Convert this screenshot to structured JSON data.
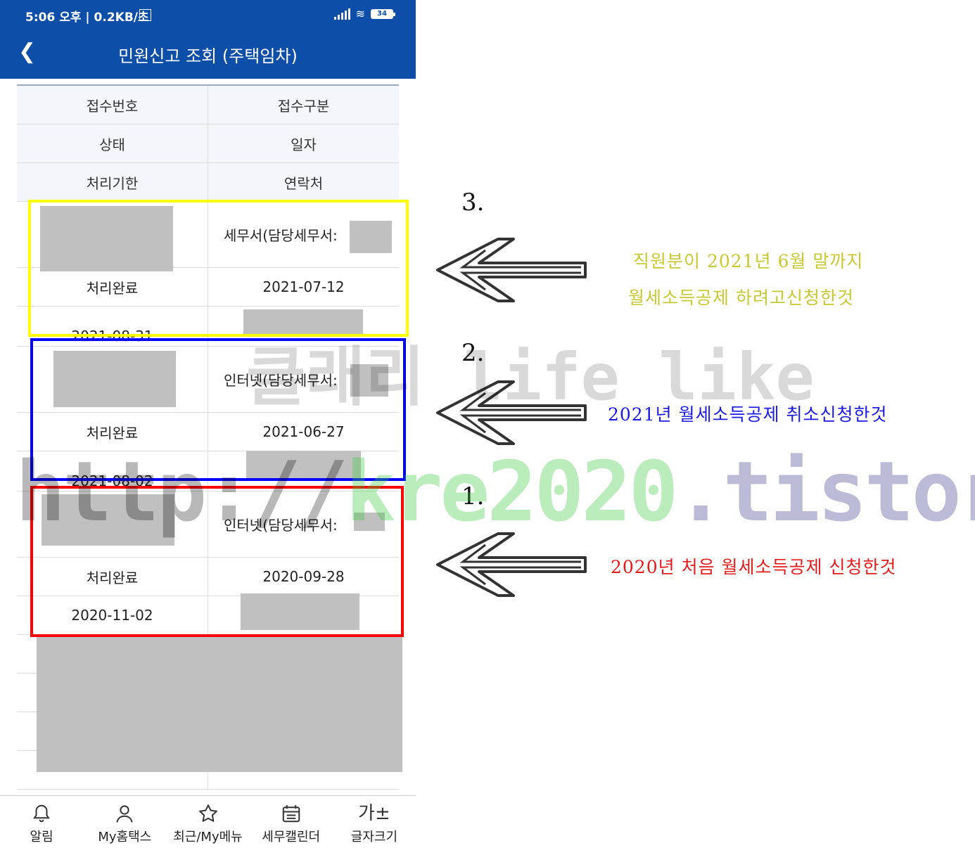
{
  "status_bar": {
    "time": "5:06 오후 | 0.2KB/초",
    "battery": "34"
  },
  "app_bar": {
    "title": "민원신고 조회 (주택임차)"
  },
  "table": {
    "header": [
      [
        "접수번호",
        "접수구분"
      ],
      [
        "상태",
        "일자"
      ],
      [
        "처리기한",
        "연락처"
      ]
    ],
    "records": [
      {
        "type": "세무서(담당세무서:",
        "status": "처리완료",
        "date": "2021-07-12",
        "deadline": "2021-08-31"
      },
      {
        "type": "인터넷(담당세무서:",
        "status": "처리완료",
        "date": "2021-06-27",
        "deadline": "2021-08-02"
      },
      {
        "type": "인터넷(담당세무서: ",
        "status": "처리완료",
        "date": "2020-09-28",
        "deadline": "2020-11-02"
      }
    ]
  },
  "bottom_nav": [
    {
      "label": "알림",
      "icon": "bell-icon"
    },
    {
      "label": "My홈택스",
      "icon": "person-icon"
    },
    {
      "label": "최근/My메뉴",
      "icon": "star-icon"
    },
    {
      "label": "세무캘린더",
      "icon": "calendar-icon"
    },
    {
      "label": "글자크기",
      "icon": "font-size-icon",
      "glyph": "가±"
    }
  ],
  "annotations": [
    {
      "number": "3.",
      "lines": [
        "직원분이 2021년 6월 말까지",
        "월세소득공제 하려고신청한것"
      ],
      "color": "#c8c832"
    },
    {
      "number": "2.",
      "lines": [
        "2021년 월세소득공제 취소신청한것"
      ],
      "color": "#1a1ae6"
    },
    {
      "number": "1.",
      "lines": [
        "2020년 처음 월세소득공제 신청한것"
      ],
      "color": "#e61a1a"
    }
  ],
  "box_colors": [
    "#ffff00",
    "#0000ff",
    "#ff0000"
  ],
  "watermark": {
    "line1": "클래리 life like",
    "line2_a": "http://",
    "line2_b": "kre2020",
    "line2_c": ".tistory.com"
  },
  "colors": {
    "primary": "#0d4ea8",
    "status_done": "#d31a1a"
  }
}
